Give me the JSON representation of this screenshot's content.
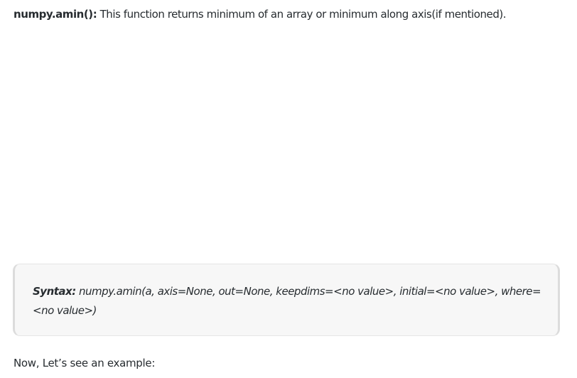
{
  "intro": {
    "term": "numpy.amin():",
    "text": " This function returns minimum of an array or minimum along axis(if mentioned)."
  },
  "syntax": {
    "label": "Syntax:",
    "code": " numpy.amin(a, axis=None, out=None, keepdims=<no value>, initial=<no value>, where=<no value>)"
  },
  "outro": {
    "text": "Now, Let’s see an example:"
  }
}
